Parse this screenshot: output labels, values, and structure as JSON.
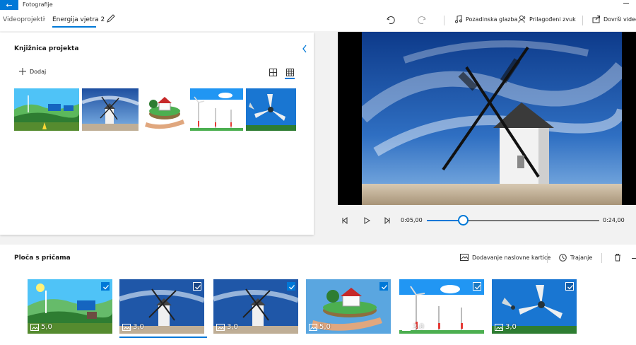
{
  "app": {
    "title": "Fotografije"
  },
  "breadcrumb": {
    "parent": "Videoprojekti",
    "current": "Energija vjetra 2"
  },
  "toolbar": {
    "background_music": "Pozadinska glazba",
    "custom_audio": "Prilagođeni zvuk",
    "finish_video": "Dovrši videozapis"
  },
  "library": {
    "title": "Knjižnica projekta",
    "add_label": "Dodaj",
    "thumbnails": [
      "green-energy-illustration",
      "windmill-photo",
      "house-on-hand-illustration",
      "wind-turbines-illustration",
      "wind-turbine-closeup"
    ]
  },
  "playback": {
    "current_time": "0:05,00",
    "total_time": "0:24,00",
    "progress": 0.21
  },
  "storyboard": {
    "title": "Ploča s pričama",
    "add_title_card": "Dodavanje naslovne kartice",
    "duration": "Trajanje",
    "cards": [
      {
        "duration": "5,0",
        "selected": true
      },
      {
        "duration": "3,0",
        "selected": false
      },
      {
        "duration": "3,0",
        "selected": true
      },
      {
        "duration": "5,0",
        "selected": true
      },
      {
        "duration": "3,0",
        "selected": false
      },
      {
        "duration": "3,0",
        "selected": false
      }
    ]
  },
  "colors": {
    "accent": "#0078d7"
  }
}
